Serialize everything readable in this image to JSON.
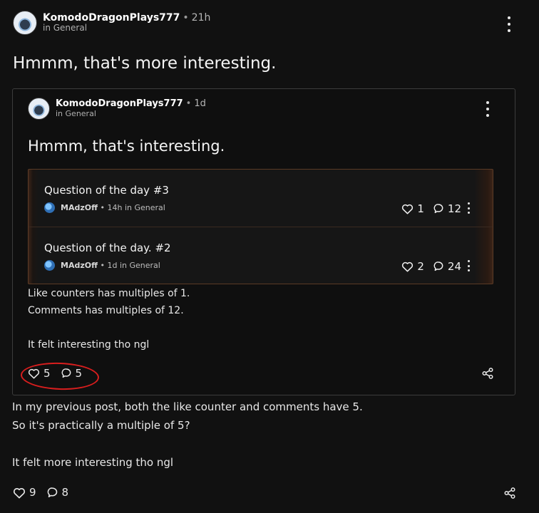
{
  "post": {
    "author": "KomodoDragonPlays777",
    "separator": "•",
    "time": "21h",
    "category": "in General",
    "title": "Hmmm, that's more interesting.",
    "body": [
      "In my previous post, both the like counter and comments have 5.",
      "So it's practically a multiple of 5?",
      "",
      "It felt more interesting tho ngl"
    ],
    "likes": "9",
    "comments": "8"
  },
  "embed": {
    "author": "KomodoDragonPlays777",
    "separator": "•",
    "time": "1d",
    "category": "in General",
    "title": "Hmmm, that's interesting.",
    "questions": [
      {
        "title": "Question of the day #3",
        "author": "MAdzOff",
        "meta": "• 14h in General",
        "likes": "1",
        "comments": "12"
      },
      {
        "title": "Question of the day. #2",
        "author": "MAdzOff",
        "meta": "• 1d in General",
        "likes": "2",
        "comments": "24"
      }
    ],
    "body": [
      "Like counters has multiples of 1.",
      "Comments has multiples of 12.",
      "",
      "It felt interesting tho ngl"
    ],
    "likes": "5",
    "comments": "5"
  },
  "colors": {
    "background": "#111111",
    "annotation": "#d81e1e",
    "embed_accent": "#5a3a25"
  },
  "icons": [
    "heart-icon",
    "comment-icon",
    "share-icon",
    "kebab-icon",
    "globe-avatar-icon"
  ]
}
